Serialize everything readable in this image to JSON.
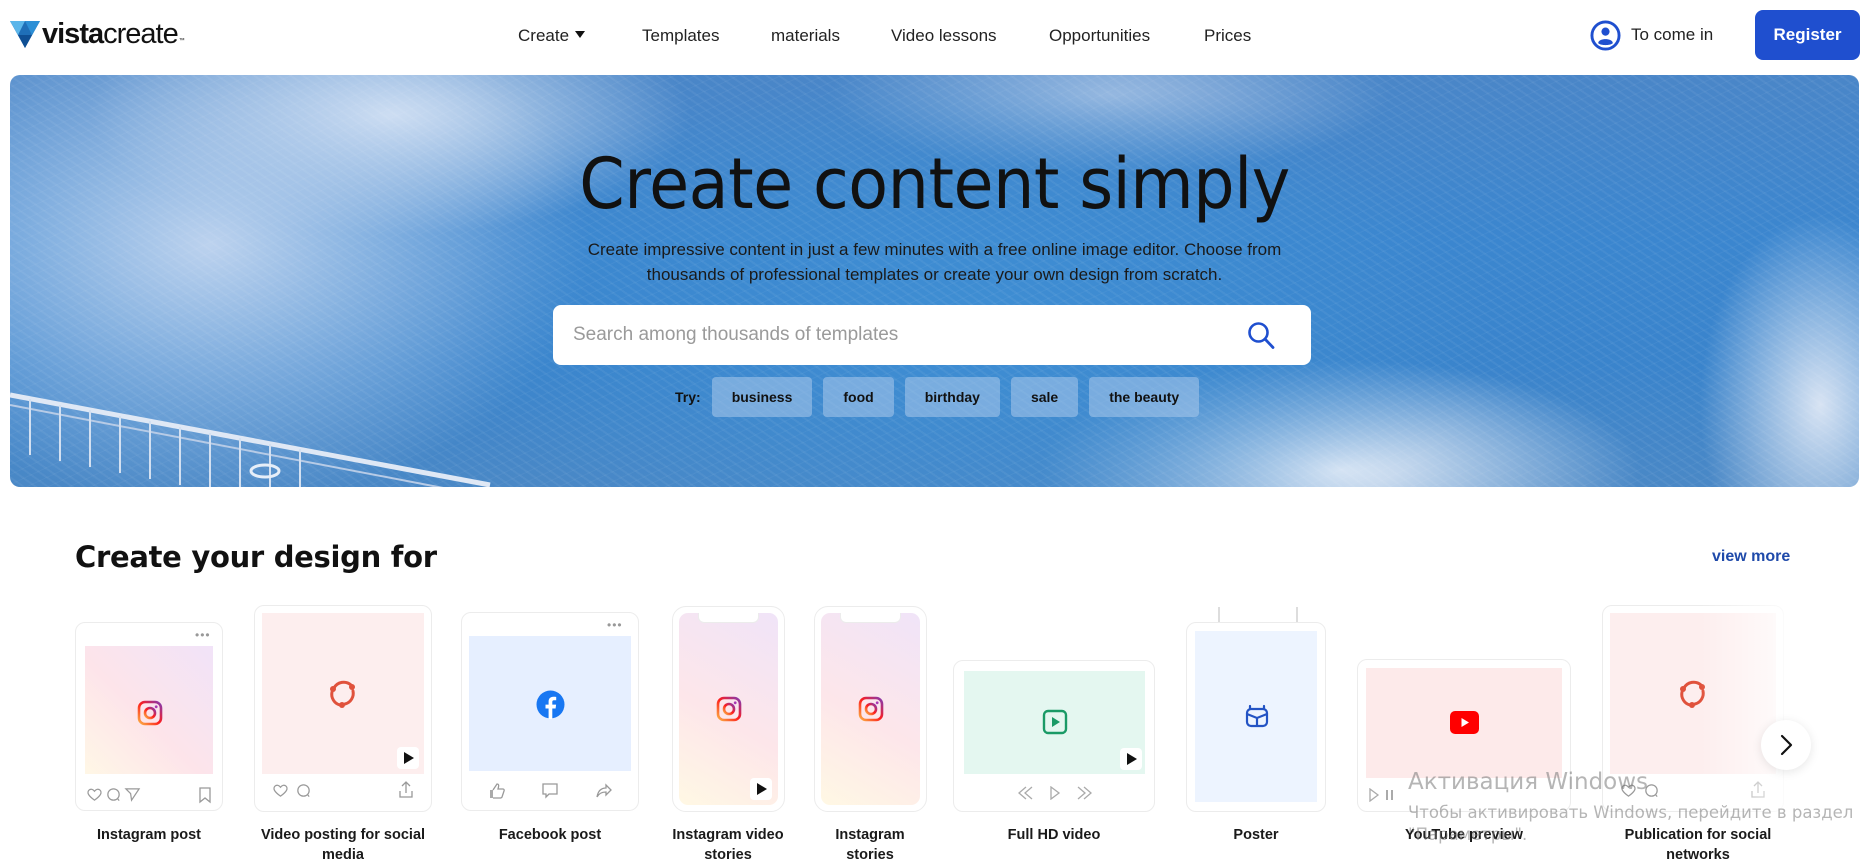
{
  "header": {
    "logo_bold": "vista",
    "logo_light": "create",
    "logo_tm": "™",
    "nav": [
      {
        "label": "Create",
        "has_dropdown": true
      },
      {
        "label": "Templates"
      },
      {
        "label": "materials"
      },
      {
        "label": "Video lessons"
      },
      {
        "label": "Opportunities"
      },
      {
        "label": "Prices"
      }
    ],
    "login_label": "To come in",
    "register_label": "Register"
  },
  "hero": {
    "title": "Create content simply",
    "subtitle_line1": "Create impressive content in just a few minutes with a free online image editor. Choose from",
    "subtitle_line2": "thousands of professional templates or create your own design from scratch.",
    "search_placeholder": "Search among thousands of templates",
    "search_value": "",
    "try_label": "Try:",
    "tags": [
      "business",
      "food",
      "birthday",
      "sale",
      "the beauty"
    ]
  },
  "design_section": {
    "title": "Create your design for",
    "view_more_label": "view more",
    "cards": [
      {
        "label_line1": "Instagram post",
        "label_line2": "",
        "icon": "instagram-icon"
      },
      {
        "label_line1": "Video posting for social",
        "label_line2": "media",
        "icon": "social-share-icon"
      },
      {
        "label_line1": "Facebook post",
        "label_line2": "",
        "icon": "facebook-icon"
      },
      {
        "label_line1": "Instagram video",
        "label_line2": "stories",
        "icon": "instagram-icon"
      },
      {
        "label_line1": "Instagram",
        "label_line2": "stories",
        "icon": "instagram-icon"
      },
      {
        "label_line1": "Full HD video",
        "label_line2": "",
        "icon": "video-play-icon"
      },
      {
        "label_line1": "Poster",
        "label_line2": "",
        "icon": "poster-icon"
      },
      {
        "label_line1": "YouTube preview",
        "label_line2": "",
        "icon": "youtube-icon"
      },
      {
        "label_line1": "Publication for social",
        "label_line2": "networks",
        "icon": "social-share-icon"
      }
    ]
  },
  "watermark": {
    "line1": "Активация Windows",
    "line2": "Чтобы активировать Windows, перейдите в раздел",
    "line3": "\"Параметры\"."
  },
  "colors": {
    "brand_blue": "#1f4fcf",
    "link_blue": "#1f4aaa",
    "youtube_red": "#ff0000",
    "facebook_blue": "#1877f2",
    "video_green": "#1a9a66"
  }
}
